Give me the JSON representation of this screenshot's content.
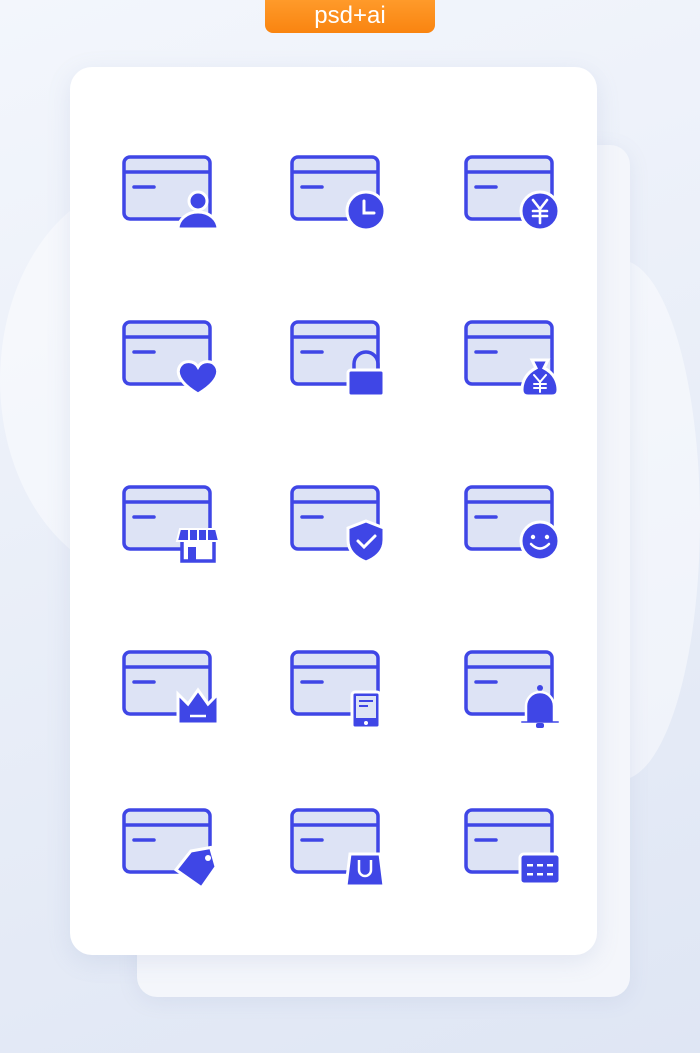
{
  "badge": {
    "label": "psd+ai",
    "color": "#f98410"
  },
  "colors": {
    "icon_stroke": "#3f46e6",
    "icon_fill": "#dde3f5"
  },
  "icons": [
    "card-user",
    "card-clock",
    "card-yen",
    "card-heart",
    "card-lock",
    "card-money-bag",
    "card-shop",
    "card-shield-check",
    "card-smiley",
    "card-crown",
    "card-phone",
    "card-bell",
    "card-tag",
    "card-shopping-bag",
    "card-keypad"
  ]
}
